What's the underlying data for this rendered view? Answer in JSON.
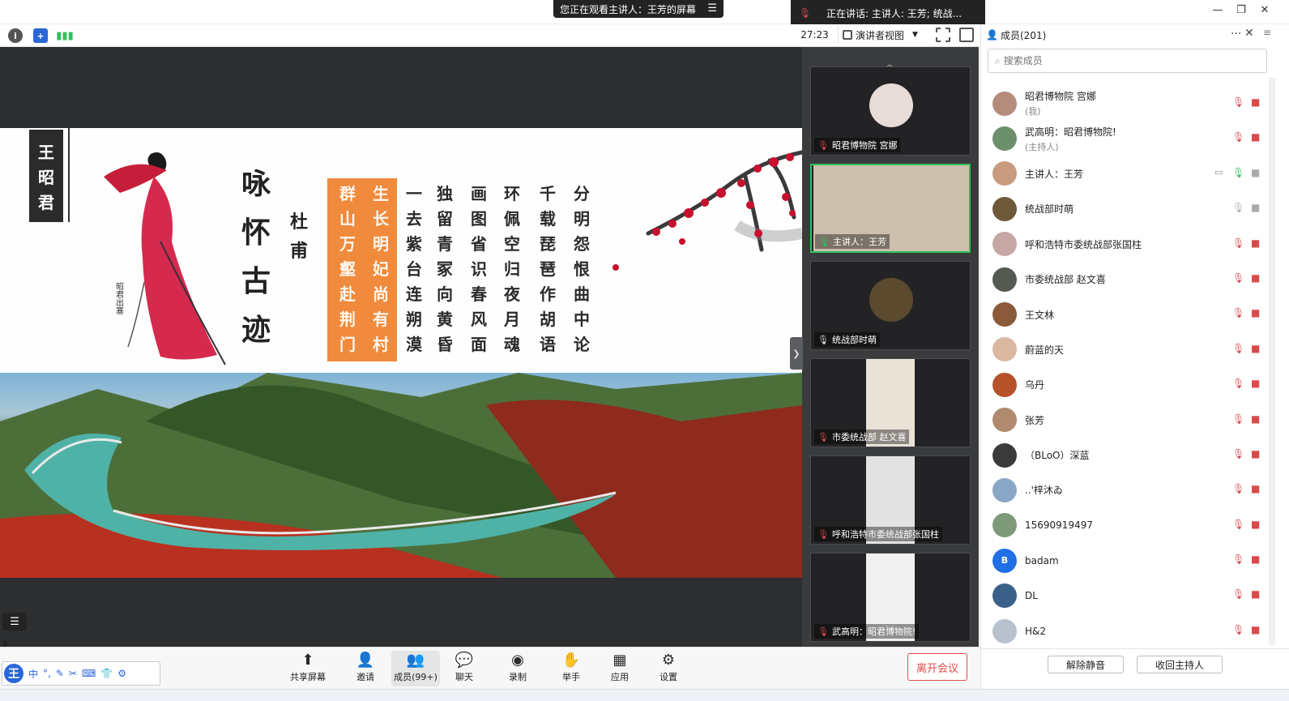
{
  "banners": {
    "watching": "您正在观看主讲人：王芳的屏幕",
    "speaking": "正在讲话: 主讲人: 王芳; 统战..."
  },
  "toolbar": {
    "timer": "27:23",
    "view_mode": "演讲者视图"
  },
  "slide": {
    "name_plate": [
      "王",
      "昭",
      "君"
    ],
    "poem_title": [
      "咏",
      "怀",
      "古",
      "迹"
    ],
    "poem_author": [
      "杜",
      "甫"
    ],
    "poem_columns": [
      [
        "群",
        "山",
        "万",
        "壑",
        "赴",
        "荆",
        "门"
      ],
      [
        "生",
        "长",
        "明",
        "妃",
        "尚",
        "有",
        "村"
      ],
      [
        "一",
        "去",
        "紫",
        "台",
        "连",
        "朔",
        "漠"
      ],
      [
        "独",
        "留",
        "青",
        "冢",
        "向",
        "黄",
        "昏"
      ],
      [
        "画",
        "图",
        "省",
        "识",
        "春",
        "风",
        "面"
      ],
      [
        "环",
        "佩",
        "空",
        "归",
        "夜",
        "月",
        "魂"
      ],
      [
        "千",
        "载",
        "琵",
        "琶",
        "作",
        "胡",
        "语"
      ],
      [
        "分",
        "明",
        "怨",
        "恨",
        "曲",
        "中",
        "论"
      ]
    ]
  },
  "tiles": [
    {
      "label": "昭君博物院 宫娜",
      "mic": "muted",
      "active": false
    },
    {
      "label": "主讲人：王芳",
      "mic": "on",
      "active": true
    },
    {
      "label": "统战部时萌",
      "mic": "idle",
      "active": false
    },
    {
      "label": "市委统战部 赵文喜",
      "mic": "muted",
      "active": false
    },
    {
      "label": "呼和浩特市委统战部张国柱",
      "mic": "muted",
      "active": false
    },
    {
      "label": "武高明：昭君博物院!",
      "mic": "muted",
      "active": false
    }
  ],
  "members_panel": {
    "title": "成员(201)",
    "search_placeholder": "搜索成员",
    "members": [
      {
        "name": "昭君博物院 宫娜",
        "sub": "(我)",
        "mic": "muted",
        "color": "#b58c7c"
      },
      {
        "name": "武高明：昭君博物院!",
        "sub": "(主持人)",
        "mic": "muted",
        "color": "#6b8f6a"
      },
      {
        "name": "主讲人：王芳",
        "sub": "",
        "mic": "on",
        "color": "#c89a7e"
      },
      {
        "name": "统战部时萌",
        "sub": "",
        "mic": "idle",
        "color": "#6e5a3a"
      },
      {
        "name": "呼和浩特市委统战部张国柱",
        "sub": "",
        "mic": "muted",
        "color": "#c7a7a3"
      },
      {
        "name": "市委统战部 赵文喜",
        "sub": "",
        "mic": "muted",
        "color": "#545a52"
      },
      {
        "name": "王文林",
        "sub": "",
        "mic": "muted",
        "color": "#8a5a3a"
      },
      {
        "name": "蔚蓝的天",
        "sub": "",
        "mic": "muted",
        "color": "#d9b7a0"
      },
      {
        "name": "乌丹",
        "sub": "",
        "mic": "muted",
        "color": "#b5522a"
      },
      {
        "name": "张芳",
        "sub": "",
        "mic": "muted",
        "color": "#b08a6e"
      },
      {
        "name": "（BLoO）深蓝",
        "sub": "",
        "mic": "muted",
        "color": "#3a3a3a"
      },
      {
        "name": "..'梓沐ゐ",
        "sub": "",
        "mic": "muted",
        "color": "#8aa6c7"
      },
      {
        "name": "15690919497",
        "sub": "",
        "mic": "muted",
        "color": "#7f9a7a"
      },
      {
        "name": "badam",
        "sub": "",
        "mic": "muted",
        "color": "#1f6fe5",
        "initial": "B"
      },
      {
        "name": "DL",
        "sub": "",
        "mic": "muted",
        "color": "#3a5f88"
      },
      {
        "name": "H&2",
        "sub": "",
        "mic": "muted",
        "color": "#b7c2ce"
      }
    ],
    "unmute_all": "解除静音",
    "reclaim_host": "收回主持人"
  },
  "bottom_bar": {
    "items": [
      {
        "label": "共享屏幕",
        "icon": "share-screen-icon"
      },
      {
        "label": "邀请",
        "icon": "invite-icon"
      },
      {
        "label": "成员(99+)",
        "icon": "members-icon"
      },
      {
        "label": "聊天",
        "icon": "chat-icon"
      },
      {
        "label": "录制",
        "icon": "record-icon"
      },
      {
        "label": "举手",
        "icon": "raise-hand-icon"
      },
      {
        "label": "应用",
        "icon": "apps-icon"
      },
      {
        "label": "设置",
        "icon": "settings-icon"
      }
    ],
    "leave": "离开会议"
  },
  "ime": {
    "logo": "王",
    "mode": "中"
  },
  "colors": {
    "accent_green": "#2fc25b",
    "danger_red": "#e24a4a",
    "poem_orange": "#f08a3c"
  }
}
